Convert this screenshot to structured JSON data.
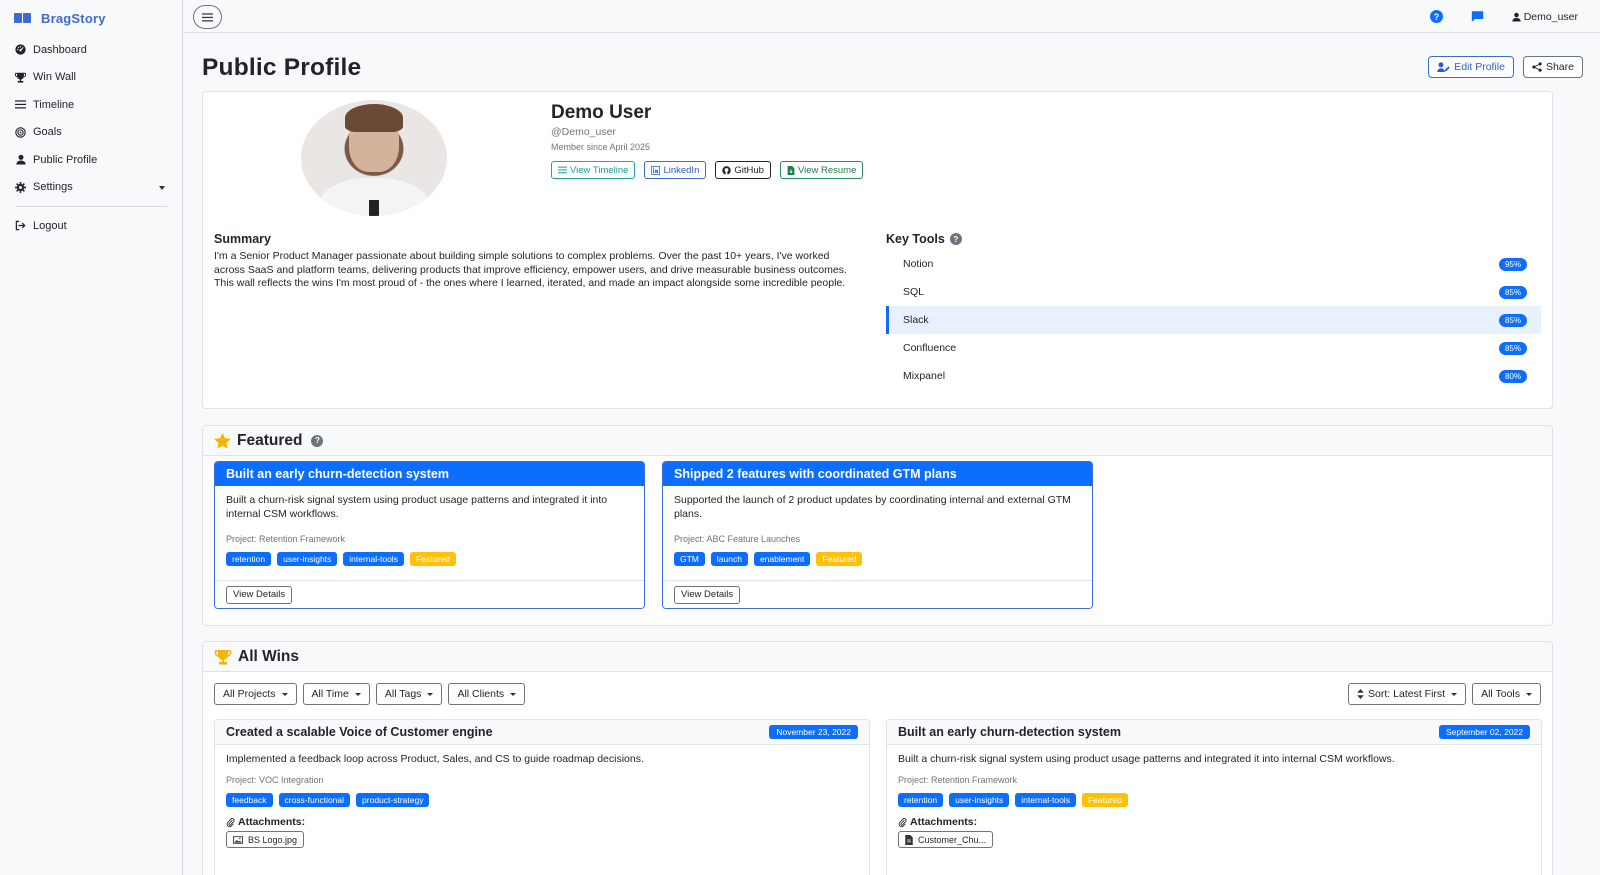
{
  "brand": {
    "name": "BragStory"
  },
  "sidebar": {
    "items": [
      {
        "label": "Dashboard",
        "icon": "gauge-icon"
      },
      {
        "label": "Win Wall",
        "icon": "trophy-icon"
      },
      {
        "label": "Timeline",
        "icon": "list-icon"
      },
      {
        "label": "Goals",
        "icon": "target-icon"
      },
      {
        "label": "Public Profile",
        "icon": "user-icon"
      },
      {
        "label": "Settings",
        "icon": "gear-icon"
      }
    ],
    "logout": "Logout"
  },
  "topbar": {
    "username": "Demo_user"
  },
  "page": {
    "title": "Public Profile",
    "edit_label": "Edit Profile",
    "share_label": "Share"
  },
  "profile": {
    "name": "Demo User",
    "handle": "@Demo_user",
    "member_since": "Member since April 2025",
    "links": {
      "timeline": "View Timeline",
      "linkedin": "LinkedIn",
      "github": "GitHub",
      "resume": "View Resume"
    },
    "summary_title": "Summary",
    "summary": "I'm a Senior Product Manager passionate about building simple solutions to complex problems. Over the past 10+ years, I've worked across SaaS and platform teams, delivering products that improve efficiency, empower users, and drive measurable business outcomes. This wall reflects the wins I'm most proud of - the ones where I learned, iterated, and made an impact alongside some incredible people.",
    "tools_title": "Key Tools",
    "tools": [
      {
        "name": "Notion",
        "pct": "95%"
      },
      {
        "name": "SQL",
        "pct": "85%"
      },
      {
        "name": "Slack",
        "pct": "85%"
      },
      {
        "name": "Confluence",
        "pct": "85%"
      },
      {
        "name": "Mixpanel",
        "pct": "80%"
      }
    ]
  },
  "featured": {
    "title": "Featured",
    "cards": [
      {
        "title": "Built an early churn-detection system",
        "desc": "Built a churn-risk signal system using product usage patterns and integrated it into internal CSM workflows.",
        "project": "Project: Retention Framework",
        "tags": [
          "retention",
          "user-insights",
          "internal-tools",
          "Featured"
        ],
        "button": "View Details"
      },
      {
        "title": "Shipped 2 features with coordinated GTM plans",
        "desc": "Supported the launch of 2 product updates by coordinating internal and external GTM plans.",
        "project": "Project: ABC Feature Launches",
        "tags": [
          "GTM",
          "launch",
          "enablement",
          "Featured"
        ],
        "button": "View Details"
      }
    ]
  },
  "wins": {
    "title": "All Wins",
    "filters": [
      "All Projects",
      "All Time",
      "All Tags",
      "All Clients"
    ],
    "sort": "Sort: Latest First",
    "tools_filter": "All Tools",
    "cards": [
      {
        "title": "Created a scalable Voice of Customer engine",
        "date": "November 23, 2022",
        "desc": "Implemented a feedback loop across Product, Sales, and CS to guide roadmap decisions.",
        "project": "Project: VOC Integration",
        "tags": [
          "feedback",
          "cross-functional",
          "product-strategy"
        ],
        "attachments_label": "Attachments:",
        "attachment": "BS Logo.jpg"
      },
      {
        "title": "Built an early churn-detection system",
        "date": "September 02, 2022",
        "desc": "Built a churn-risk signal system using product usage patterns and integrated it into internal CSM workflows.",
        "project": "Project: Retention Framework",
        "tags": [
          "retention",
          "user-insights",
          "internal-tools",
          "Featured"
        ],
        "attachments_label": "Attachments:",
        "attachment": "Customer_Chu..."
      }
    ]
  },
  "colors": {
    "primary": "#0d6efd",
    "featured": "#ffc107",
    "brand": "#3d6bd6"
  }
}
